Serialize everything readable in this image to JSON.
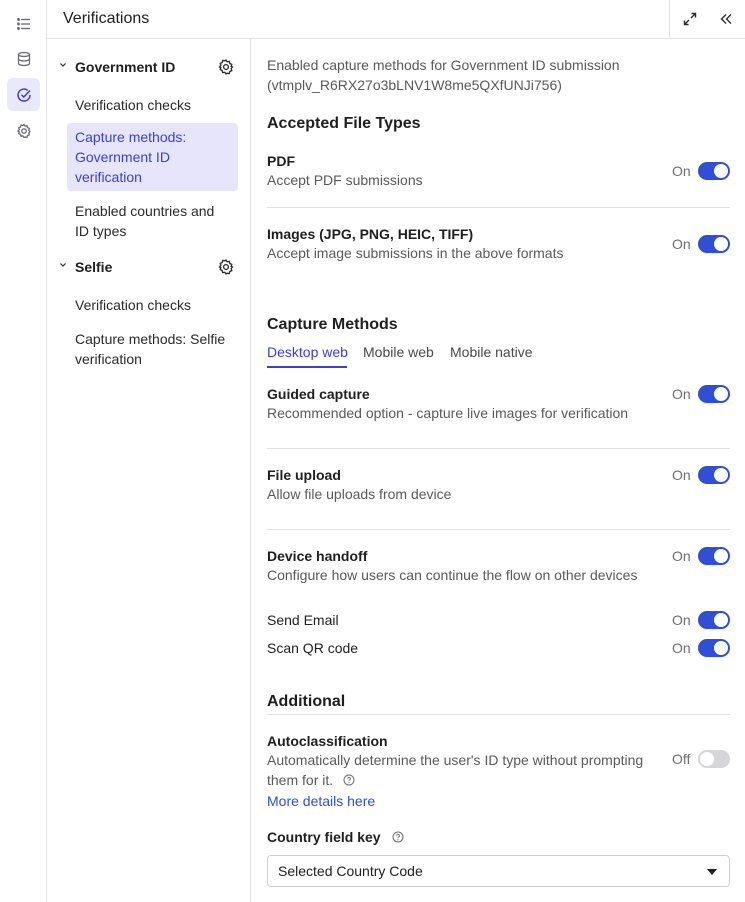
{
  "header": {
    "title": "Verifications"
  },
  "rail": {
    "items": [
      "list-icon",
      "database-icon",
      "check-circle-icon",
      "gear-icon"
    ]
  },
  "nav": {
    "groups": [
      {
        "label": "Government ID",
        "items": [
          "Verification checks",
          "Capture methods: Government ID verification",
          "Enabled countries and ID types"
        ]
      },
      {
        "label": "Selfie",
        "items": [
          "Verification checks",
          "Capture methods: Selfie verification"
        ]
      }
    ]
  },
  "main": {
    "description": "Enabled capture methods for Government ID submission (vtmplv_R6RX27o3bLNV1W8me5QXfUNJi756)",
    "accepted": {
      "title": "Accepted File Types",
      "rows": [
        {
          "title": "PDF",
          "subtitle": "Accept PDF submissions",
          "state": "On"
        },
        {
          "title": "Images (JPG, PNG, HEIC, TIFF)",
          "subtitle": "Accept image submissions in the above formats",
          "state": "On"
        }
      ]
    },
    "capture": {
      "title": "Capture Methods",
      "tabs": [
        "Desktop web",
        "Mobile web",
        "Mobile native"
      ],
      "rows": [
        {
          "title": "Guided capture",
          "subtitle": "Recommended option - capture live images for verification",
          "state": "On"
        },
        {
          "title": "File upload",
          "subtitle": "Allow file uploads from device",
          "state": "On"
        },
        {
          "title": "Device handoff",
          "subtitle": "Configure how users can continue the flow on other devices",
          "state": "On"
        }
      ],
      "subrows": [
        {
          "label": "Send Email",
          "state": "On"
        },
        {
          "label": "Scan QR code",
          "state": "On"
        }
      ]
    },
    "additional": {
      "title": "Additional",
      "autoclass_title": "Autoclassification",
      "autoclass_sub": "Automatically determine the user's ID type without prompting them for it.",
      "autoclass_state": "Off",
      "link": "More details here",
      "country_label": "Country field key",
      "country_value": "Selected Country Code"
    }
  },
  "colors": {
    "accent": "#2f4fd6",
    "selected_bg": "#e6e5fb",
    "toggle_off": "#d6d6d9"
  }
}
